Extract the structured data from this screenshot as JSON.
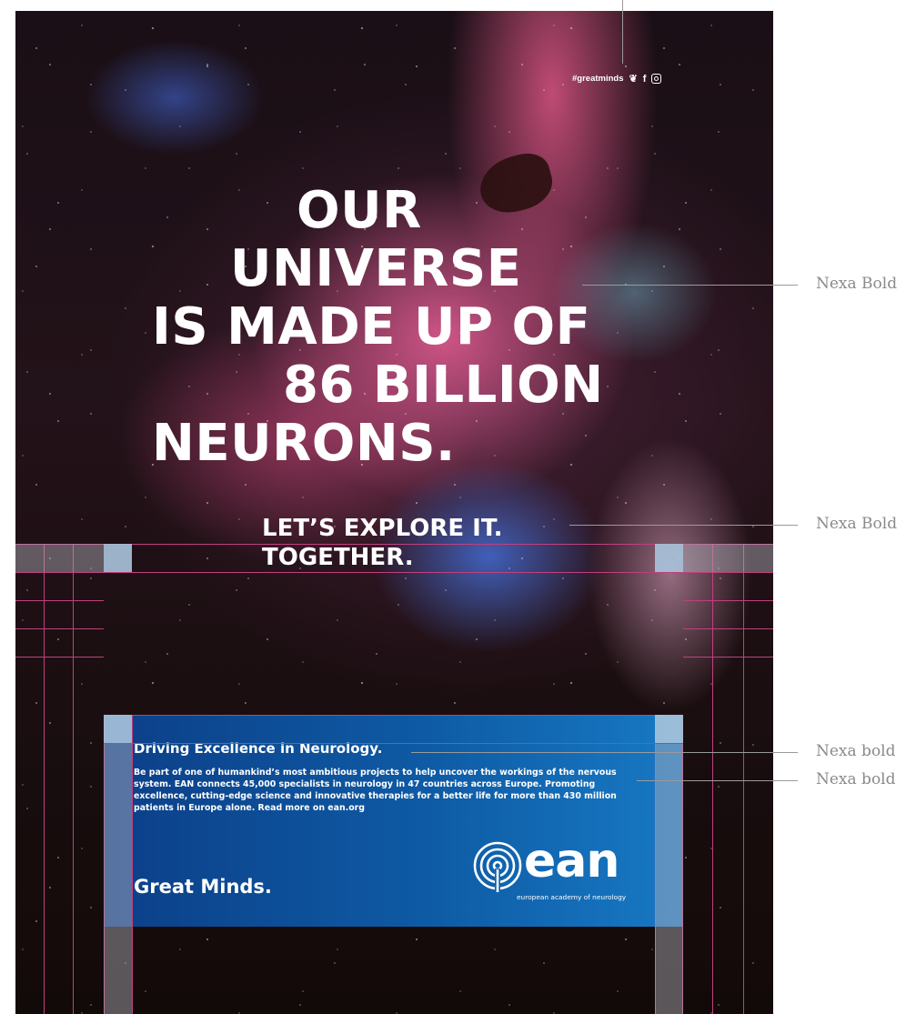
{
  "social": {
    "hashtag": "#greatminds",
    "twitter_icon": "twitter-icon",
    "facebook_icon": "facebook-icon",
    "instagram_icon": "instagram-icon"
  },
  "headline": {
    "line1": "OUR",
    "line2": "UNIVERSE",
    "line3": "IS MADE UP OF",
    "line4": "86 BILLION",
    "line5": "NEURONS."
  },
  "subhead": {
    "line1": "LET’S EXPLORE IT.",
    "line2": "TOGETHER."
  },
  "infobox": {
    "title": "Driving Excellence in Neurology.",
    "body": "Be part of one of humankind’s most ambitious projects to help uncover the workings of the nervous system. EAN connects 45,000 specialists in neurology in 47 countries across Europe. Promoting excellence, cutting-edge science and innovative therapies for a better life for more than 430 million patients in Europe alone. Read more on ean.org",
    "tagline": "Great Minds.",
    "logo_word": "ean",
    "logo_sub": "european academy of neurology"
  },
  "annotations": {
    "headline_font": "Nexa Bold",
    "subhead_font": "Nexa Bold",
    "title_font": "Nexa bold",
    "body_font": "Nexa bold"
  },
  "colors": {
    "infobox": "#0e5aa4",
    "guide": "#c0407e",
    "annotation": "#8a8a8a"
  }
}
